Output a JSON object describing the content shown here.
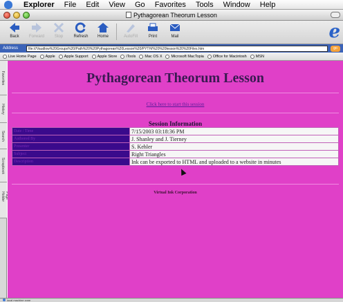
{
  "menubar": {
    "app": "Explorer",
    "items": [
      "File",
      "Edit",
      "View",
      "Go",
      "Favorites",
      "Tools",
      "Window",
      "Help"
    ]
  },
  "window": {
    "title": "Pythagorean Theorum Lesson"
  },
  "toolbar": {
    "back": "Back",
    "forward": "Forward",
    "stop": "Stop",
    "refresh": "Refresh",
    "home": "Home",
    "autofill": "AutoFill",
    "print": "Print",
    "mail": "Mail"
  },
  "address": {
    "label": "Address",
    "value": "file:///Vaudlow%20Groups%20/Path%20%20Pythagorean%20Lesson%20/PYTH/%20%20lesson%20%20Files.htm",
    "go": "go"
  },
  "favorites": [
    "Live Home Page",
    "Apple",
    "Apple Support",
    "Apple Store",
    "iTools",
    "Mac OS X",
    "Microsoft MacTopia",
    "Office for Macintosh",
    "MSN"
  ],
  "sidetabs": [
    "Favorites",
    "History",
    "Search",
    "Scrapbook",
    "Page Holder"
  ],
  "page": {
    "title": "Pythagorean Theorum Lesson",
    "start_link": "Click here to start this session",
    "session_heading": "Session Information",
    "rows": [
      {
        "label": "Date / Time",
        "value": "7/15/2003 03:18:36 PM"
      },
      {
        "label": "Authored By",
        "value": "J. Shanley and J. Tierney"
      },
      {
        "label": "Presenter",
        "value": "S. Kehler"
      },
      {
        "label": "Subject",
        "value": "Right Triangles"
      },
      {
        "label": "Description",
        "value": "Ink can be exported to HTML and uploaded to a website in minutes"
      }
    ],
    "footer": "Virtual Ink Corporation"
  },
  "status": {
    "text": "local machine zone"
  },
  "colors": {
    "page_bg": "#e040c8",
    "title": "#3a1a52",
    "label_cell": "#3a0a8c",
    "address_bar": "#3b63b8"
  }
}
